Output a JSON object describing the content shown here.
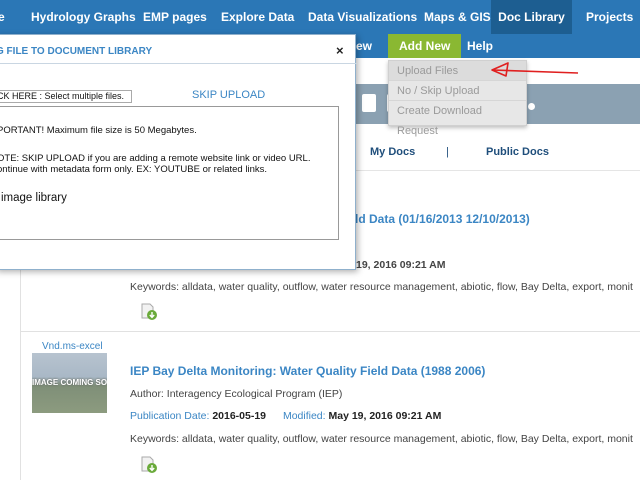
{
  "nav": {
    "items": [
      "e",
      "Hydrology Graphs",
      "EMP pages",
      "Explore Data",
      "Data Visualizations",
      "Maps & GIS",
      "Doc Library",
      "Projects"
    ]
  },
  "subnav": {
    "partial": "ew",
    "add_new": "Add New",
    "help": "Help"
  },
  "dropdown": {
    "items": [
      "Upload Files",
      "No / Skip Upload",
      "Create Download Request"
    ]
  },
  "tabs": {
    "my_docs": "My Docs",
    "separator": "|",
    "public_docs": "Public Docs"
  },
  "docs": [
    {
      "title": "ld Data (01/16/2013 12/10/2013)",
      "modified_fragment": "19, 2016 09:21 AM",
      "keywords": "Keywords: alldata, water quality, outflow, water resource management, abiotic, flow, Bay Delta, export, monit"
    },
    {
      "file_type": "Vnd.ms-excel",
      "thumb_text": "IMAGE COMING SOON",
      "title": "IEP Bay Delta Monitoring: Water Quality Field Data (1988 2006)",
      "author": "Author: Interagency Ecological Program (IEP)",
      "pub_label": "Publication Date:",
      "pub_date": "2016-05-19",
      "mod_label": "Modified:",
      "mod_date": "May 19, 2016 09:21 AM",
      "keywords": "Keywords: alldata, water quality, outflow, water resource management, abiotic, flow, Bay Delta, export, monit"
    }
  ],
  "modal": {
    "title": "G FILE TO DOCUMENT LIBRARY",
    "close": "×",
    "choose_files": "CK HERE : Select multiple files.",
    "skip_upload": "SKIP UPLOAD",
    "important": "PORTANT! Maximum file size is 50 Megabytes.",
    "note1": "OTE: SKIP UPLOAD if you are adding a remote website link or video URL.",
    "note2": "ontinue with metadata form only. EX: YOUTUBE or related links.",
    "image_library": "image library"
  },
  "colors": {
    "nav_bg": "#2b77b6",
    "nav_active": "#1d5e91",
    "add_new": "#8ab832",
    "link_blue": "#3b86c4",
    "arrow_red": "#e02020"
  }
}
